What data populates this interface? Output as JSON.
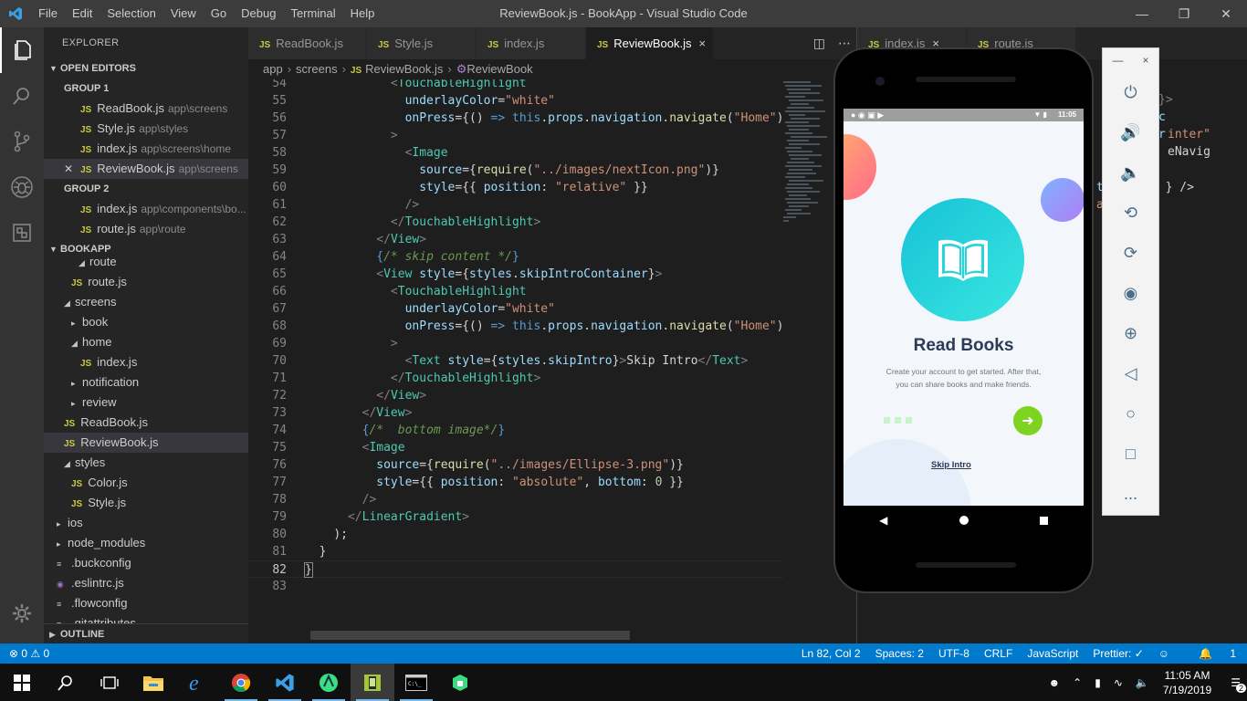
{
  "titlebar": {
    "menu": [
      "File",
      "Edit",
      "Selection",
      "View",
      "Go",
      "Debug",
      "Terminal",
      "Help"
    ],
    "title": "ReviewBook.js - BookApp - Visual Studio Code"
  },
  "sidebar": {
    "header": "EXPLORER",
    "open_editors_title": "OPEN EDITORS",
    "group1_title": "GROUP 1",
    "group1": [
      {
        "name": "ReadBook.js",
        "path": "app\\screens"
      },
      {
        "name": "Style.js",
        "path": "app\\styles"
      },
      {
        "name": "index.js",
        "path": "app\\screens\\home"
      },
      {
        "name": "ReviewBook.js",
        "path": "app\\screens"
      }
    ],
    "group2_title": "GROUP 2",
    "group2": [
      {
        "name": "index.js",
        "path": "app\\components\\bo..."
      },
      {
        "name": "route.js",
        "path": "app\\route"
      }
    ],
    "project_title": "BOOKAPP",
    "tree": [
      {
        "name": "route",
        "type": "folder-open"
      },
      {
        "name": "route.js",
        "type": "js"
      },
      {
        "name": "screens",
        "type": "folder-open"
      },
      {
        "name": "book",
        "type": "folder"
      },
      {
        "name": "home",
        "type": "folder-open"
      },
      {
        "name": "index.js",
        "type": "js"
      },
      {
        "name": "notification",
        "type": "folder"
      },
      {
        "name": "review",
        "type": "folder"
      },
      {
        "name": "ReadBook.js",
        "type": "js"
      },
      {
        "name": "ReviewBook.js",
        "type": "js"
      },
      {
        "name": "styles",
        "type": "folder-open"
      },
      {
        "name": "Color.js",
        "type": "js"
      },
      {
        "name": "Style.js",
        "type": "js"
      },
      {
        "name": "ios",
        "type": "folder"
      },
      {
        "name": "node_modules",
        "type": "folder"
      },
      {
        "name": ".buckconfig",
        "type": "file"
      },
      {
        "name": ".eslintrc.js",
        "type": "eslint"
      },
      {
        "name": ".flowconfig",
        "type": "file"
      },
      {
        "name": ".gitattributes",
        "type": "file"
      }
    ],
    "outline_title": "OUTLINE"
  },
  "tabs": [
    {
      "label": "ReadBook.js"
    },
    {
      "label": "Style.js"
    },
    {
      "label": "index.js"
    },
    {
      "label": "ReviewBook.js",
      "close": "×"
    }
  ],
  "group2_tabs": [
    {
      "label": "index.js",
      "close": "×"
    },
    {
      "label": "route.js"
    }
  ],
  "breadcrumb": [
    "app",
    "screens",
    "ReviewBook.js",
    "ReviewBook"
  ],
  "code": {
    "line_numbers": [
      "54",
      "55",
      "56",
      "57",
      "58",
      "59",
      "60",
      "61",
      "62",
      "63",
      "64",
      "65",
      "66",
      "67",
      "68",
      "69",
      "70",
      "71",
      "72",
      "73",
      "74",
      "75",
      "76",
      "77",
      "78",
      "79",
      "80",
      "81",
      "82",
      "83"
    ],
    "current_line": "82"
  },
  "group2_code_fragments": [
    "}>",
    "c",
    "r",
    "inter\"",
    "eNavig",
    "t",
    "} />",
    "a"
  ],
  "status": {
    "problems": "⊗ 0 ⚠ 0",
    "position": "Ln 82, Col 2",
    "spaces": "Spaces: 2",
    "encoding": "UTF-8",
    "eol": "CRLF",
    "language": "JavaScript",
    "prettier": "Prettier: ✓",
    "notifications": "1"
  },
  "emulator": {
    "time": "11:05",
    "heading": "Read Books",
    "body_line1": "Create your account to get started. After that,",
    "body_line2": "you can share books and make friends.",
    "skip": "Skip Intro",
    "panel_close": "×",
    "panel_min": "—",
    "more": "..."
  },
  "taskbar": {
    "time": "11:05 AM",
    "date": "7/19/2019",
    "notif_count": "2"
  },
  "colors": {
    "accent": "#007acc",
    "teal": "#1ed7d6",
    "green_button": "#7ed321"
  }
}
